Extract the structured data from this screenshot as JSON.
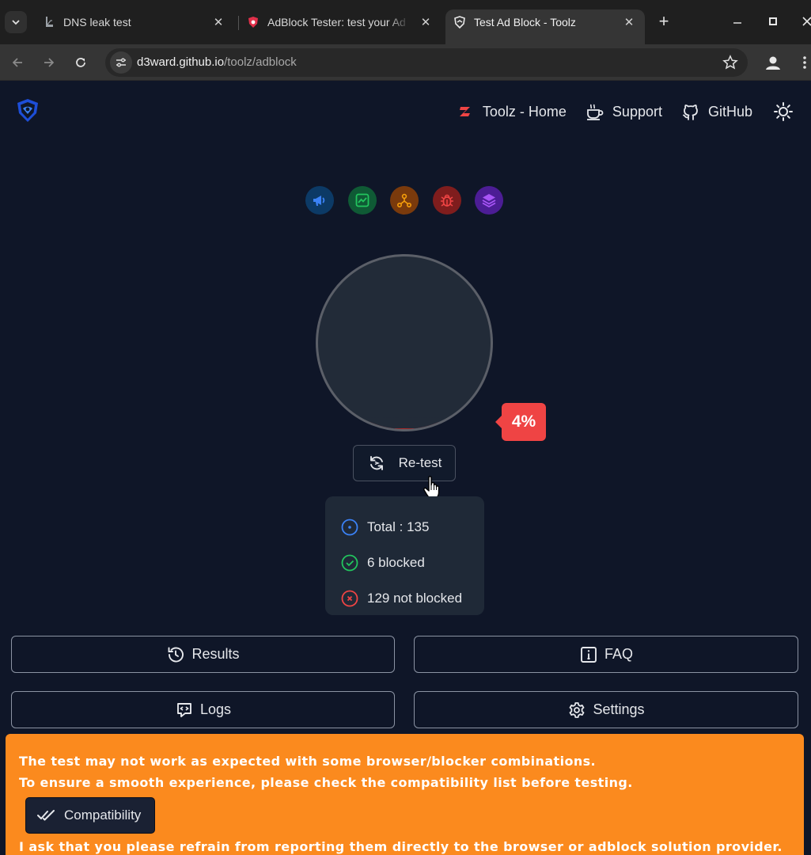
{
  "browser": {
    "tabs": [
      {
        "title": "DNS leak test",
        "icon": "dns-leak-favicon"
      },
      {
        "title": "AdBlock Tester: test your Ad",
        "icon": "shield-favicon"
      },
      {
        "title": "Test Ad Block - Toolz",
        "icon": "shield-favicon",
        "active": true
      }
    ],
    "close_glyph": "✕",
    "new_tab_glyph": "+",
    "url_host": "d3ward.github.io",
    "url_path": "/toolz/adblock"
  },
  "header": {
    "nav": [
      {
        "label": "Toolz - Home",
        "icon": "toolz-z-icon"
      },
      {
        "label": "Support",
        "icon": "coffee-icon"
      },
      {
        "label": "GitHub",
        "icon": "github-icon"
      }
    ]
  },
  "categories": [
    {
      "name": "ads",
      "icon": "megaphone-icon",
      "bg": "#0c3a66",
      "fg": "#3b82f6"
    },
    {
      "name": "analytics",
      "icon": "chart-icon",
      "bg": "#0f5a35",
      "fg": "#22c55e"
    },
    {
      "name": "trackers",
      "icon": "network-icon",
      "bg": "#7a3a0c",
      "fg": "#f59e0b"
    },
    {
      "name": "error-monitors",
      "icon": "bug-icon",
      "bg": "#7f1d1d",
      "fg": "#ef4444"
    },
    {
      "name": "oem",
      "icon": "layers-icon",
      "bg": "#4c1d95",
      "fg": "#a855f7"
    }
  ],
  "gauge": {
    "percent": 4,
    "label": "4%",
    "fill_color": "#b02a2a"
  },
  "retest_label": "Re-test",
  "stats": {
    "total": "Total : 135",
    "blocked": "6 blocked",
    "not_blocked": "129 not blocked"
  },
  "buttons": {
    "results": "Results",
    "faq": "FAQ",
    "logs": "Logs",
    "settings": "Settings"
  },
  "alert": {
    "line1": "The test may not work as expected with some browser/blocker combinations.",
    "line2": "To ensure a smooth experience, please check the compatibility list before testing.",
    "button": "Compatibility",
    "line3": "I ask that you please refrain from reporting them directly to the browser or adblock solution provider.",
    "bg": "#fb8a1e"
  }
}
